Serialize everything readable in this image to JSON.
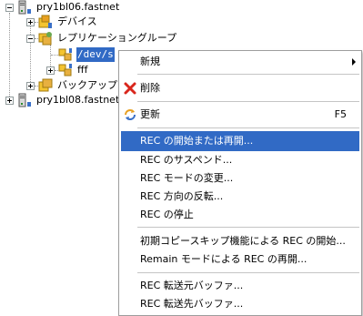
{
  "tree": {
    "server1": "pry1bl06.fastnet",
    "devices": "デバイス",
    "replication_group": "レプリケーショングループ",
    "selected_node": "/dev/s",
    "fff": "fff",
    "backup": "バックアップ",
    "server2": "pry1bl08.fastnet"
  },
  "context_menu": {
    "new": "新規",
    "delete": "削除",
    "refresh": "更新",
    "refresh_shortcut": "F5",
    "rec_start_restart": "REC の開始または再開...",
    "rec_suspend": "REC のサスペンド...",
    "rec_mode_change": "REC モードの変更...",
    "rec_reverse": "REC 方向の反転...",
    "rec_stop": "REC の停止",
    "rec_start_initial_copy_skip": "初期コピースキップ機能による REC の開始...",
    "rec_start_remain_mode": "Remain モードによる REC の再開...",
    "rec_source_buffer": "REC 転送元バッファ...",
    "rec_dest_buffer": "REC 転送先バッファ..."
  },
  "colors": {
    "selection": "#316ac5",
    "delete_icon": "#d9261c",
    "folder": "#f4c430"
  },
  "icons": {
    "server": "server-icon",
    "devices": "devices-icon",
    "group": "replication-group-icon",
    "pair": "replication-pair-icon",
    "backup": "backup-icon",
    "delete": "delete-x-icon",
    "refresh": "refresh-icon"
  }
}
